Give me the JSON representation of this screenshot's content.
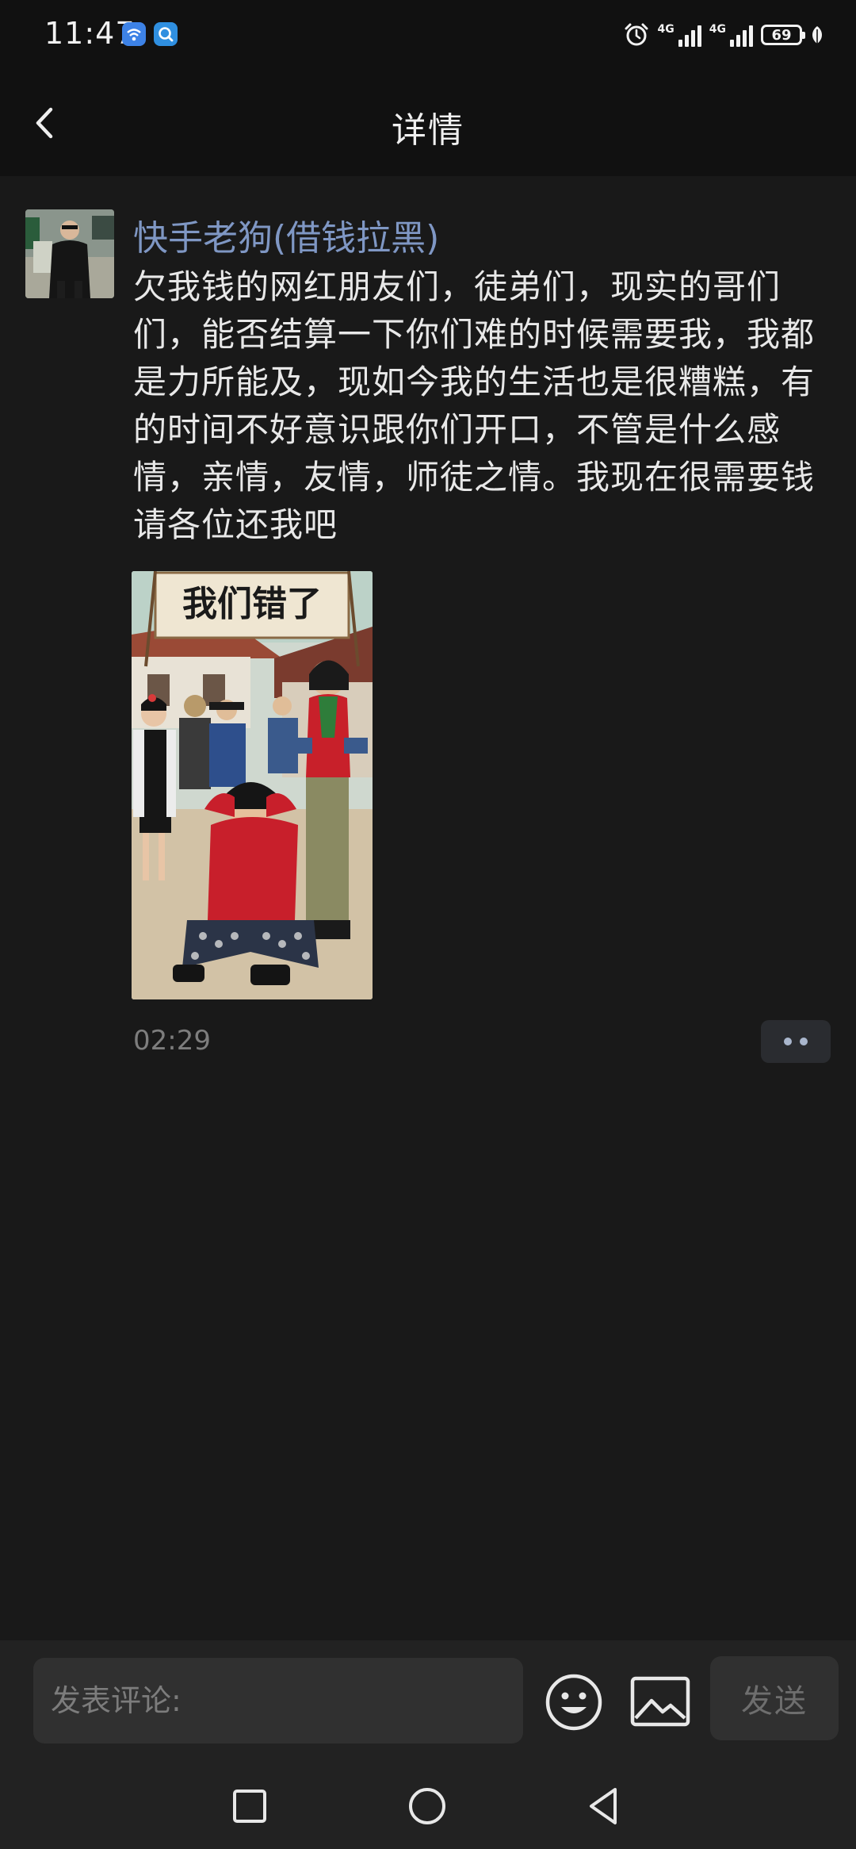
{
  "status_bar": {
    "time": "11:47",
    "sim1_label": "4G",
    "sim2_label": "4G",
    "battery": "69",
    "colors": {
      "app_icon_wifi": "#3d82e6",
      "app_icon_search": "#2f8fe0"
    }
  },
  "header": {
    "title": "详情",
    "back_icon": "chevron-left-icon"
  },
  "post": {
    "author": "快手老狗(借钱拉黑)",
    "text": "欠我钱的网红朋友们，徒弟们，现实的哥们们，能否结算一下你们难的时候需要我，我都是力所能及，现如今我的生活也是很糟糕，有的时间不好意识跟你们开口，不管是什么感情，亲情，友情，师徒之情。我现在很需要钱请各位还我吧",
    "image_banner": "我们错了",
    "time": "02:29",
    "author_color": "#7f97c4"
  },
  "comment_bar": {
    "placeholder": "发表评论:",
    "send_label": "发送",
    "emoji_icon": "smiley-icon",
    "image_icon": "image-icon"
  },
  "nav_bar": {
    "recents_icon": "square-icon",
    "home_icon": "circle-icon",
    "back_icon": "triangle-back-icon"
  }
}
